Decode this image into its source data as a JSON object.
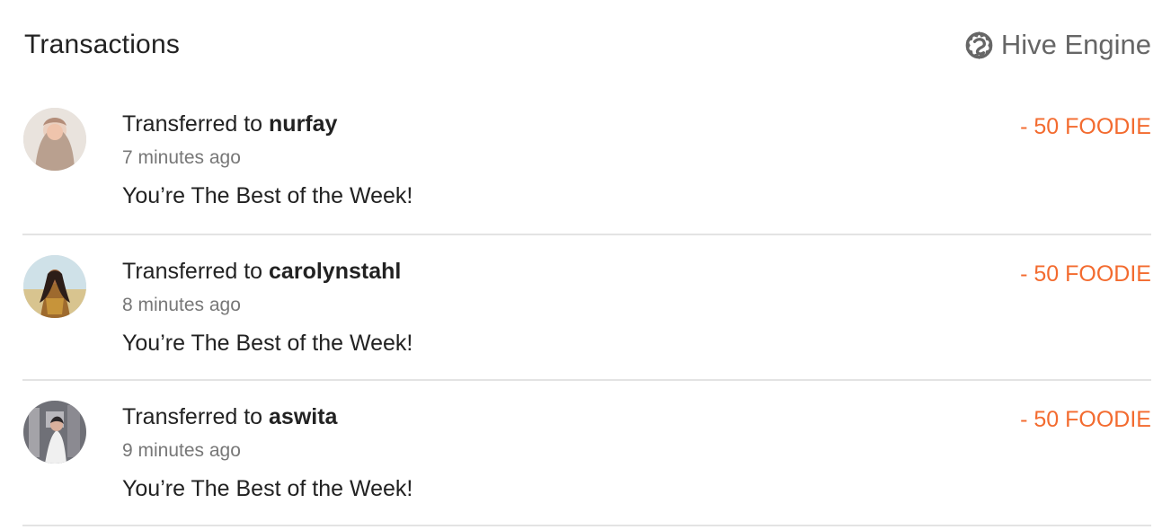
{
  "header": {
    "title": "Transactions",
    "source_label": "Hive Engine",
    "source_icon": "hive-engine-icon"
  },
  "colors": {
    "amount": "#f36b2f",
    "muted": "#777777",
    "divider": "#e3e3e3",
    "text": "#222222"
  },
  "transactions": [
    {
      "action": "Transferred to ",
      "recipient": "nurfay",
      "time": "7 minutes ago",
      "memo": "You’re The Best of the Week!",
      "amount": "- 50 FOODIE",
      "avatar_icon": "user-avatar"
    },
    {
      "action": "Transferred to ",
      "recipient": "carolynstahl",
      "time": "8 minutes ago",
      "memo": "You’re The Best of the Week!",
      "amount": "- 50 FOODIE",
      "avatar_icon": "user-avatar"
    },
    {
      "action": "Transferred to ",
      "recipient": "aswita",
      "time": "9 minutes ago",
      "memo": "You’re The Best of the Week!",
      "amount": "- 50 FOODIE",
      "avatar_icon": "user-avatar"
    }
  ]
}
